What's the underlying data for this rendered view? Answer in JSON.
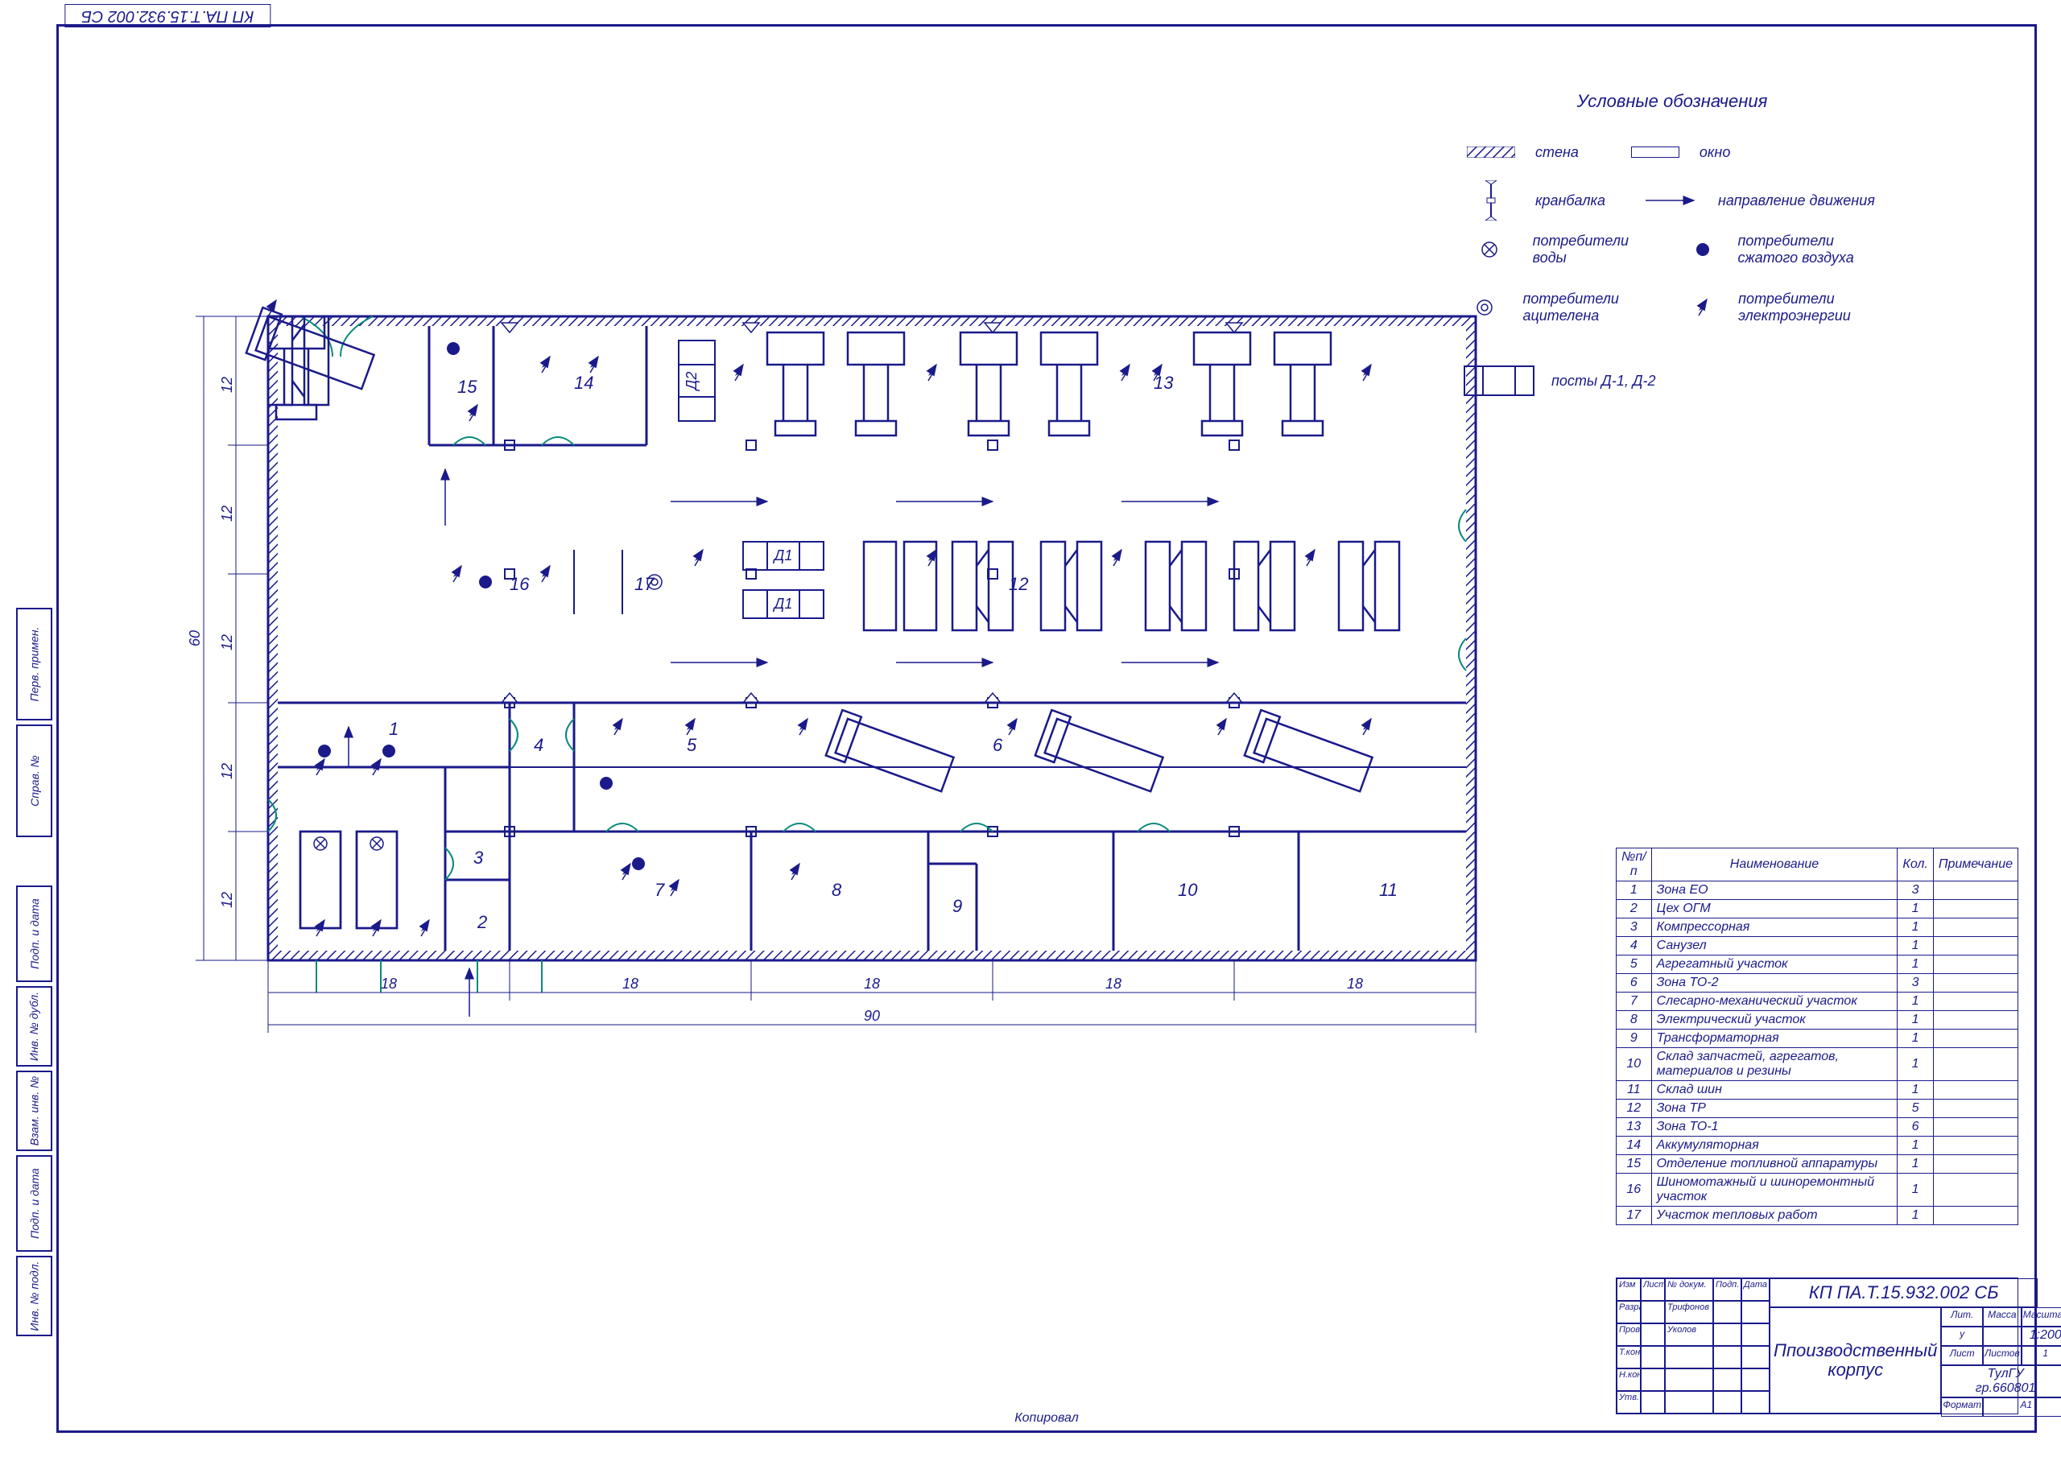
{
  "drawing_code": "КП ПА.Т.15.932.002 СБ",
  "drawing_title_l1": "Ппоизводственный",
  "drawing_title_l2": "корпус",
  "legend_title": "Условные обозначения",
  "legend": {
    "wall": "стена",
    "window": "окно",
    "crane": "кранбалка",
    "flow": "направление движения",
    "water": "потребители воды",
    "air": "потребители сжатого воздуха",
    "acet": "потребители ацителена",
    "elec": "потребители электроэнергии",
    "posts": "посты Д-1, Д-2"
  },
  "dims": {
    "total_w": "90",
    "total_h": "60",
    "bay_w": "18",
    "bay_h": "12"
  },
  "post_labels": {
    "d1": "Д1",
    "d2": "Д2"
  },
  "spec_headers": {
    "num": "№п/п",
    "name": "Наименование",
    "qty": "Кол.",
    "note": "Примечание"
  },
  "spec": [
    {
      "n": "1",
      "name": "Зона ЕО",
      "q": "3",
      "note": ""
    },
    {
      "n": "2",
      "name": "Цех ОГМ",
      "q": "1",
      "note": ""
    },
    {
      "n": "3",
      "name": "Компрессорная",
      "q": "1",
      "note": ""
    },
    {
      "n": "4",
      "name": "Санузел",
      "q": "1",
      "note": ""
    },
    {
      "n": "5",
      "name": "Агрегатный участок",
      "q": "1",
      "note": ""
    },
    {
      "n": "6",
      "name": "Зона ТО-2",
      "q": "3",
      "note": ""
    },
    {
      "n": "7",
      "name": "Слесарно-механический участок",
      "q": "1",
      "note": ""
    },
    {
      "n": "8",
      "name": "Электрический участок",
      "q": "1",
      "note": ""
    },
    {
      "n": "9",
      "name": "Трансформаторная",
      "q": "1",
      "note": ""
    },
    {
      "n": "10",
      "name": "Склад запчастей, агрегатов, материалов и резины",
      "q": "1",
      "note": ""
    },
    {
      "n": "11",
      "name": "Склад шин",
      "q": "1",
      "note": ""
    },
    {
      "n": "12",
      "name": "Зона ТР",
      "q": "5",
      "note": ""
    },
    {
      "n": "13",
      "name": "Зона ТО-1",
      "q": "6",
      "note": ""
    },
    {
      "n": "14",
      "name": "Аккумуляторная",
      "q": "1",
      "note": ""
    },
    {
      "n": "15",
      "name": "Отделение топливной аппаратуры",
      "q": "1",
      "note": ""
    },
    {
      "n": "16",
      "name": "Шиномотажный и шиноремонтный участок",
      "q": "1",
      "note": ""
    },
    {
      "n": "17",
      "name": "Участок тепловых работ",
      "q": "1",
      "note": ""
    }
  ],
  "title_block": {
    "scale": "1:200",
    "lit": "Лит.",
    "mass": "Масса",
    "msht": "Масштаб",
    "list": "Лист",
    "listov": "Листов",
    "listov_n": "1",
    "org_l1": "ТулГУ",
    "org_l2": "гр.660801",
    "format": "Формат",
    "format_v": "А1",
    "rows": [
      "Изм",
      "Лист",
      "№ докум.",
      "Подп.",
      "Дата"
    ],
    "roles": [
      "Разраб.",
      "Пров.",
      "Т.контр",
      "",
      "Н.контр",
      "Утв."
    ],
    "names": [
      "Трифонов",
      "Уколов",
      "",
      "",
      "",
      ""
    ]
  },
  "bottom": "Копировал",
  "sidebar": [
    "Инв. № подл.",
    "Подп. и дата",
    "Взам. инв. №",
    "Инв. № дубл.",
    "Подп. и дата",
    "Справ. №",
    "Перв. примен."
  ]
}
